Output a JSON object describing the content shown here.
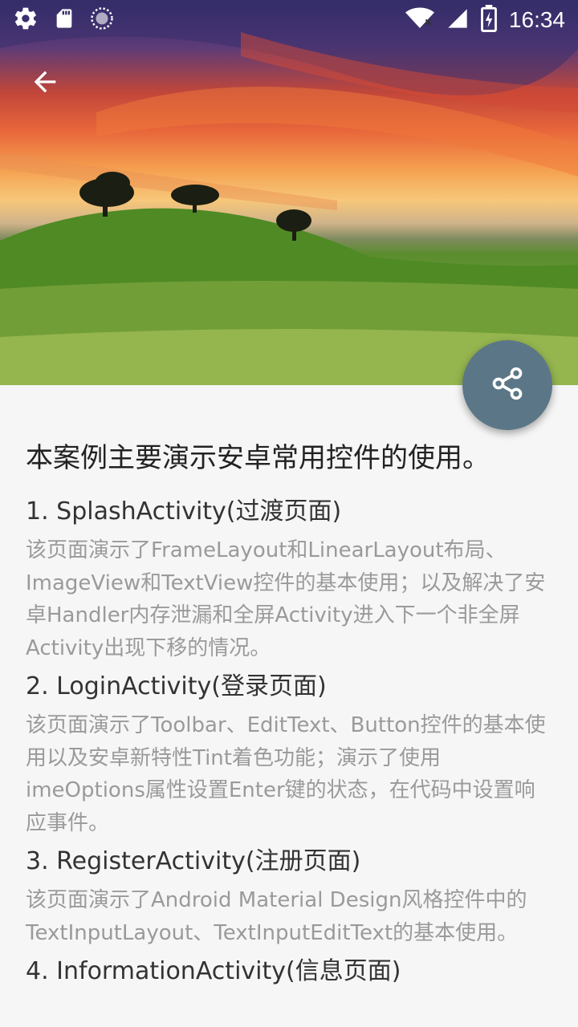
{
  "status_bar": {
    "time": "16:34",
    "left_icons": [
      "gear-icon",
      "sd-card-icon",
      "sync-icon"
    ],
    "right_icons": [
      "wifi-icon",
      "signal-icon",
      "battery-charging-icon"
    ]
  },
  "toolbar": {
    "back_icon": "arrow-left-icon"
  },
  "fab": {
    "icon": "share-icon",
    "color": "#5b7787"
  },
  "content": {
    "intro": "本案例主要演示安卓常用控件的使用。",
    "sections": [
      {
        "title": "1. SplashActivity(过渡页面)",
        "desc": "该页面演示了FrameLayout和LinearLayout布局、ImageView和TextView控件的基本使用；以及解决了安卓Handler内存泄漏和全屏Activity进入下一个非全屏Activity出现下移的情况。"
      },
      {
        "title": "2. LoginActivity(登录页面)",
        "desc": "该页面演示了Toolbar、EditText、Button控件的基本使用以及安卓新特性Tint着色功能；演示了使用imeOptions属性设置Enter键的状态，在代码中设置响应事件。"
      },
      {
        "title": "3. RegisterActivity(注册页面)",
        "desc": "该页面演示了Android Material Design风格控件中的TextInputLayout、TextInputEditText的基本使用。"
      },
      {
        "title": "4. InformationActivity(信息页面)",
        "desc": ""
      }
    ]
  }
}
